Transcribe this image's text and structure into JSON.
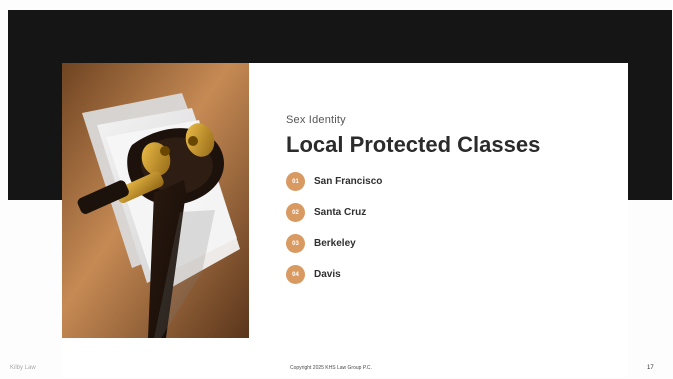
{
  "slide": {
    "eyebrow": "Sex Identity",
    "title": "Local Protected Classes",
    "items": [
      {
        "badge": "01",
        "label": "San Francisco"
      },
      {
        "badge": "02",
        "label": "Santa Cruz"
      },
      {
        "badge": "03",
        "label": "Berkeley"
      },
      {
        "badge": "04",
        "label": "Davis"
      }
    ],
    "footer": {
      "left": "Kilby Law",
      "center": "Copyright 2025 KHS Law Group P.C.",
      "page_number": "17"
    }
  },
  "colors": {
    "dark_band": "#151515",
    "badge": "#d99a62",
    "title": "#2b2b2b"
  },
  "icons": {
    "photo": "gavel-on-books-icon"
  }
}
